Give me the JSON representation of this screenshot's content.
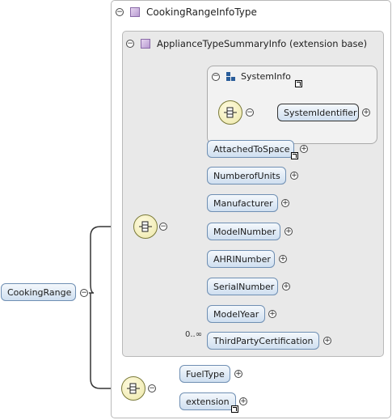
{
  "root_element": {
    "label": "CookingRange"
  },
  "complex_type": {
    "label": "CookingRangeInfoType"
  },
  "extension_base": {
    "label": "ApplianceTypeSummaryInfo (extension base)"
  },
  "system_info": {
    "label": "SystemInfo"
  },
  "system_identifier": {
    "label": "SystemIdentifier"
  },
  "sequence_children": [
    {
      "label": "AttachedToSpace"
    },
    {
      "label": "NumberofUnits"
    },
    {
      "label": "Manufacturer"
    },
    {
      "label": "ModelNumber"
    },
    {
      "label": "AHRINumber"
    },
    {
      "label": "SerialNumber"
    },
    {
      "label": "ModelYear"
    },
    {
      "label": "ThirdPartyCertification",
      "occurrence": "0..∞"
    }
  ],
  "bottom_children": [
    {
      "label": "FuelType"
    },
    {
      "label": "extension"
    }
  ],
  "colors": {
    "element_fill_top": "#f4f8fc",
    "element_fill_bottom": "#cfdff0",
    "element_border": "#6f8fb3",
    "compositor_fill": "#ece7a8",
    "panel_bg": "#e9e9e9",
    "type_icon": "#b79ad0"
  }
}
